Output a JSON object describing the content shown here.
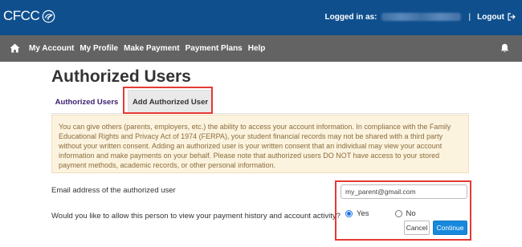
{
  "header": {
    "logo_text": "CFCC",
    "logged_in_label": "Logged in as:",
    "separator": "|",
    "logout_label": "Logout",
    "background_color": "#0f4f8e"
  },
  "nav": {
    "items": [
      {
        "label": "My Account"
      },
      {
        "label": "My Profile"
      },
      {
        "label": "Make Payment"
      },
      {
        "label": "Payment Plans"
      },
      {
        "label": "Help"
      }
    ],
    "background_color": "#636363"
  },
  "main": {
    "title": "Authorized Users",
    "tabs": [
      {
        "label": "Authorized Users",
        "active": false
      },
      {
        "label": "Add Authorized User",
        "active": true
      }
    ],
    "notice": "You can give others (parents, employers, etc.) the ability to access your account information. In compliance with the Family Educational Rights and Privacy Act of 1974 (FERPA), your student financial records may not be shared with a third party without your written consent. Adding an authorized user is your written consent that an individual may view your account information and make payments on your behalf. Please note that authorized users DO NOT have access to your stored payment methods, academic records, or other personal information.",
    "form": {
      "email_label": "Email address of the authorized user",
      "email_value": "my_parent@gmail.com",
      "allow_label": "Would you like to allow this person to view your payment history and account activity?",
      "options": [
        {
          "label": "Yes",
          "selected": true
        },
        {
          "label": "No",
          "selected": false
        }
      ],
      "cancel_label": "Cancel",
      "continue_label": "Continue"
    },
    "highlight_color": "#e53935",
    "primary_color": "#1789dc"
  }
}
